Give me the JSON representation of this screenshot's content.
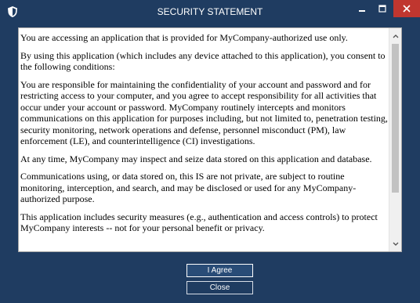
{
  "window": {
    "title": "SECURITY STATEMENT",
    "colors": {
      "frame": "#1f3c61",
      "close_button": "#c0362f",
      "text_bg": "#ffffff"
    }
  },
  "titlebar_icons": {
    "app": "shield-icon",
    "minimize": "minimize-icon",
    "maximize": "maximize-icon",
    "close": "close-icon"
  },
  "statement": {
    "paragraphs": [
      "You are accessing an application that is provided for MyCompany-authorized use only.",
      "By using this application (which includes any device attached to this application), you consent to the following conditions:",
      "You are responsible for maintaining the confidentiality of your account and password and for restricting access to your computer, and you agree to accept responsibility for all activities that occur under your account or password. MyCompany routinely intercepts and monitors communications on this application for purposes including, but not limited to, penetration testing, security monitoring, network operations and defense, personnel misconduct (PM), law enforcement (LE), and counterintelligence (CI) investigations.",
      "At any time, MyCompany may inspect and seize data stored on this application and database.",
      "Communications using, or data stored on, this IS are not private, are subject to routine monitoring, interception, and search, and may be disclosed or used for any MyCompany-authorized purpose.",
      "This application includes security measures (e.g., authentication and access controls) to protect MyCompany interests -- not for your personal benefit or privacy."
    ]
  },
  "buttons": {
    "agree": "I Agree",
    "close": "Close"
  }
}
